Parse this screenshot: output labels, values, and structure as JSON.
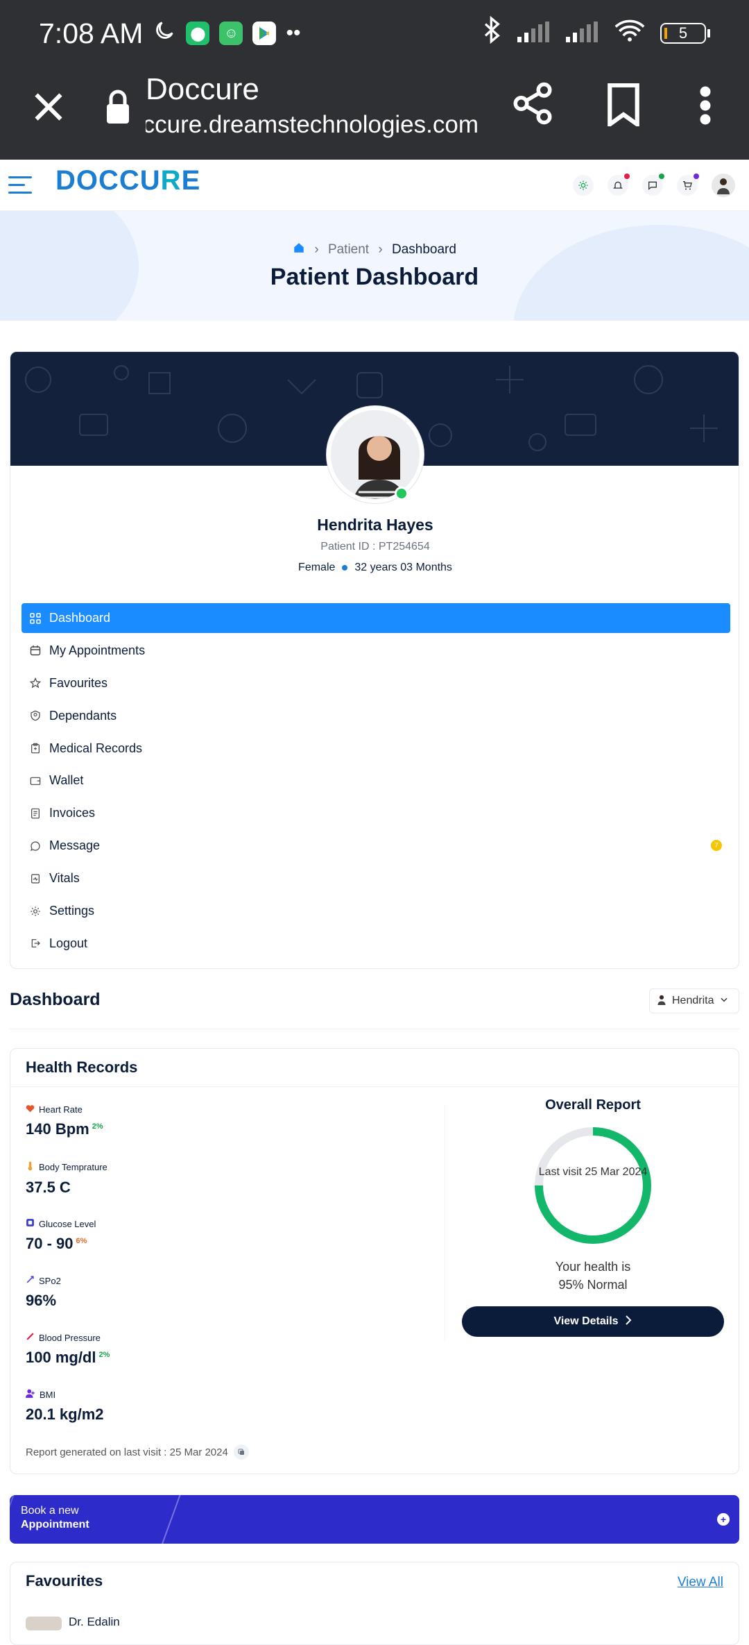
{
  "status_bar": {
    "time": "7:08 AM",
    "battery": "5"
  },
  "browser": {
    "site_title": "Doccure",
    "domain": "doccure.dreamstechnologies.com"
  },
  "header": {
    "logo": "DOCCURE"
  },
  "breadcrumb": {
    "home_icon": "home-icon",
    "parent": "Patient",
    "current": "Dashboard"
  },
  "page_title": "Patient Dashboard",
  "profile": {
    "name": "Hendrita Hayes",
    "patient_id": "Patient ID : PT254654",
    "gender": "Female",
    "age": "32 years 03 Months"
  },
  "menu": {
    "items": [
      {
        "label": "Dashboard",
        "icon": "grid-icon"
      },
      {
        "label": "My Appointments",
        "icon": "calendar-icon"
      },
      {
        "label": "Favourites",
        "icon": "star-icon"
      },
      {
        "label": "Dependants",
        "icon": "user-shield-icon"
      },
      {
        "label": "Medical Records",
        "icon": "clipboard-icon"
      },
      {
        "label": "Wallet",
        "icon": "wallet-icon"
      },
      {
        "label": "Invoices",
        "icon": "invoice-icon"
      },
      {
        "label": "Message",
        "icon": "chat-icon"
      },
      {
        "label": "Vitals",
        "icon": "vitals-icon"
      },
      {
        "label": "Settings",
        "icon": "gear-icon"
      },
      {
        "label": "Logout",
        "icon": "logout-icon"
      }
    ],
    "message_badge": "7"
  },
  "dashboard": {
    "title": "Dashboard",
    "patient_select": "Hendrita"
  },
  "health_records": {
    "title": "Health Records",
    "metrics": [
      {
        "label": "Heart Rate",
        "value": "140 Bpm",
        "change": "2%",
        "trend": "up",
        "icon": "heart-icon",
        "color": "#e4572e"
      },
      {
        "label": "Body Temprature",
        "value": "37.5 C",
        "change": "",
        "trend": "",
        "icon": "thermometer-icon",
        "color": "#e9a23b"
      },
      {
        "label": "Glucose Level",
        "value": "70 - 90",
        "change": "6%",
        "trend": "down",
        "icon": "glucose-icon",
        "color": "#3b3fcf"
      },
      {
        "label": "SPo2",
        "value": "96%",
        "change": "",
        "trend": "",
        "icon": "spo2-icon",
        "color": "#4f46e5"
      },
      {
        "label": "Blood Pressure",
        "value": "100 mg/dl",
        "change": "2%",
        "trend": "up",
        "icon": "blood-pressure-icon",
        "color": "#e11d48"
      },
      {
        "label": "BMI",
        "value": "20.1 kg/m2",
        "change": "",
        "trend": "",
        "icon": "bmi-icon",
        "color": "#6d28d9"
      }
    ],
    "overall": {
      "title": "Overall Report",
      "last_visit": "Last visit 25 Mar 2024",
      "health_line1": "Your health is",
      "health_line2": "95% Normal",
      "percent": 0.75,
      "button": "View Details"
    },
    "report_note": "Report generated on last visit : 25 Mar 2024"
  },
  "book": {
    "line1": "Book a new",
    "line2": "Appointment"
  },
  "favourites": {
    "title": "Favourites",
    "view_all": "View All",
    "first_doctor": "Dr. Edalin"
  },
  "colors": {
    "primary": "#1a8cff",
    "navy": "#0b1c3a",
    "success": "#16a34a",
    "book": "#2d2bc9"
  }
}
